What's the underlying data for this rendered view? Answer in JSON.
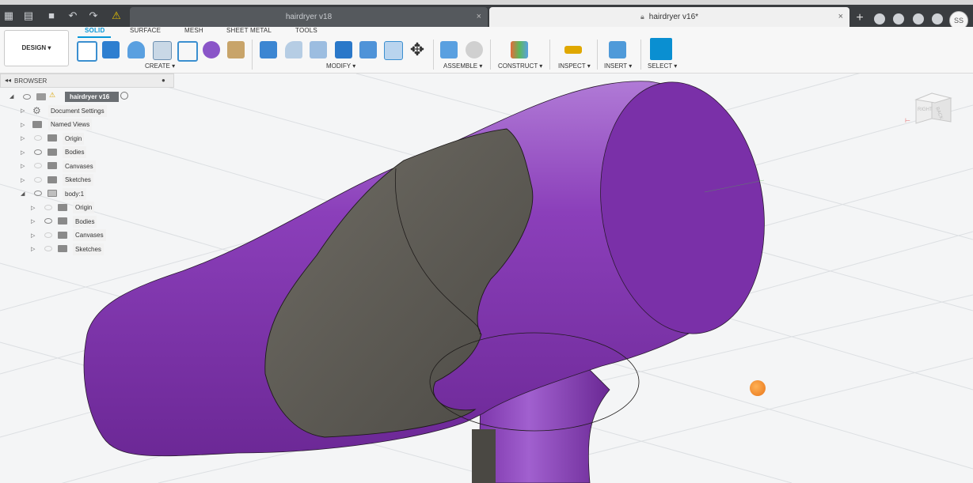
{
  "tabs": {
    "inactive_label": "hairdryer v18",
    "active_label": "hairdryer v16*",
    "close_glyph": "×",
    "new_tab_glyph": "+"
  },
  "user": {
    "initials": "SS"
  },
  "workspace": {
    "label": "DESIGN ▾"
  },
  "ribbon_tabs": [
    "SOLID",
    "SURFACE",
    "MESH",
    "SHEET METAL",
    "TOOLS"
  ],
  "groups": {
    "create": "CREATE ▾",
    "modify": "MODIFY ▾",
    "assemble": "ASSEMBLE ▾",
    "construct": "CONSTRUCT ▾",
    "inspect": "INSPECT ▾",
    "insert": "INSERT ▾",
    "select": "SELECT ▾"
  },
  "browser": {
    "title": "BROWSER",
    "root": "hairdryer v16",
    "items": {
      "document_settings": "Document Settings",
      "named_views": "Named Views",
      "origin": "Origin",
      "bodies": "Bodies",
      "canvases": "Canvases",
      "sketches": "Sketches",
      "component": "body:1",
      "sub_origin": "Origin",
      "sub_bodies": "Bodies",
      "sub_canvases": "Canvases",
      "sub_sketches": "Sketches"
    }
  },
  "viewcube": {
    "right": "RIGHT",
    "back": "BACK"
  },
  "colors": {
    "model_purple": "#8a3fb8",
    "model_cut": "#6e6a62",
    "accent": "#0696d7"
  }
}
